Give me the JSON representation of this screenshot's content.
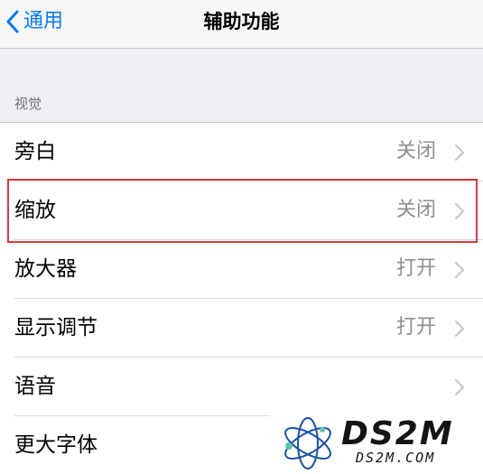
{
  "navbar": {
    "back_label": "通用",
    "title": "辅助功能"
  },
  "section": {
    "header": "视觉"
  },
  "rows": [
    {
      "label": "旁白",
      "value": "关闭"
    },
    {
      "label": "缩放",
      "value": "关闭"
    },
    {
      "label": "放大器",
      "value": "打开"
    },
    {
      "label": "显示调节",
      "value": "打开"
    },
    {
      "label": "语音",
      "value": ""
    },
    {
      "label": "更大字体",
      "value": ""
    }
  ],
  "watermark": {
    "big": "DS2M",
    "small": "DS2M.COM"
  },
  "colors": {
    "accent": "#007aff",
    "secondary_text": "#8e8e93",
    "highlight_border": "#d93a3a",
    "background": "#efeff4"
  }
}
